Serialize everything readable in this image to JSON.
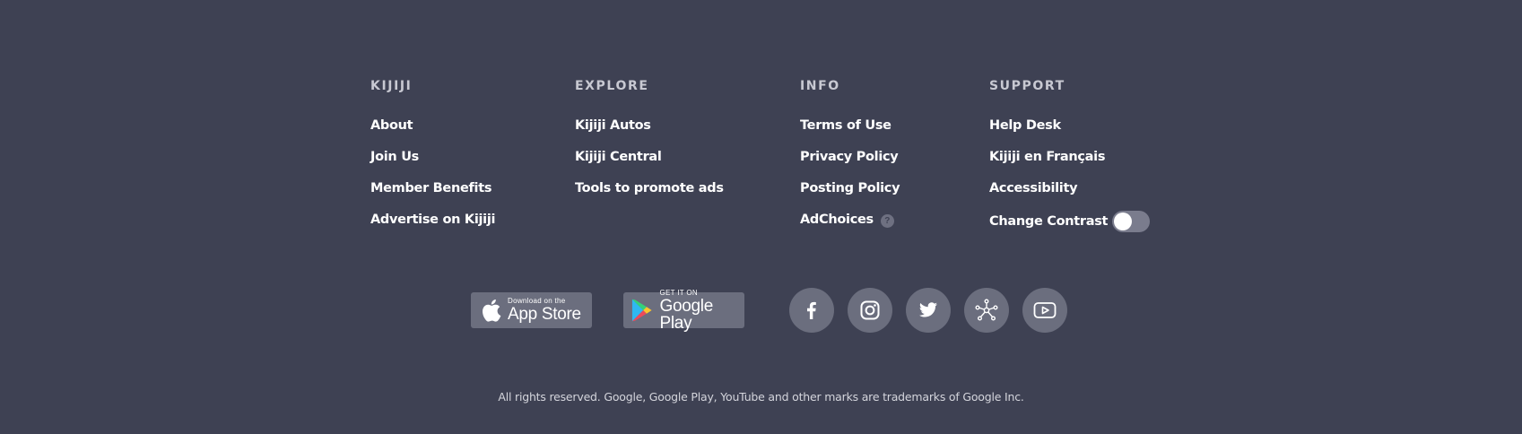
{
  "columns": [
    {
      "title": "KIJIJI",
      "links": [
        "About",
        "Join Us",
        "Member Benefits",
        "Advertise on Kijiji"
      ]
    },
    {
      "title": "EXPLORE",
      "links": [
        "Kijiji Autos",
        "Kijiji Central",
        "Tools to promote ads"
      ]
    },
    {
      "title": "INFO",
      "links": [
        "Terms of Use",
        "Privacy Policy",
        "Posting Policy",
        "AdChoices"
      ]
    },
    {
      "title": "SUPPORT",
      "links": [
        "Help Desk",
        "Kijiji en Français",
        "Accessibility",
        "Change Contrast"
      ]
    }
  ],
  "help_glyph": "?",
  "contrast_toggle": {
    "state": "off"
  },
  "app_store": {
    "small": "Download on the",
    "big": "App Store",
    "icon": "apple-icon"
  },
  "google_play": {
    "small": "GET IT ON",
    "big": "Google Play",
    "icon": "google-play-icon"
  },
  "social": [
    "facebook-icon",
    "instagram-icon",
    "twitter-icon",
    "network-icon",
    "youtube-icon"
  ],
  "copyright": "All rights reserved. Google, Google Play, YouTube and other marks are trademarks of Google Inc.",
  "colors": {
    "background": "#3e4153",
    "heading": "#c8c9d2",
    "link": "#ffffff",
    "badge": "#6b6e7e"
  }
}
